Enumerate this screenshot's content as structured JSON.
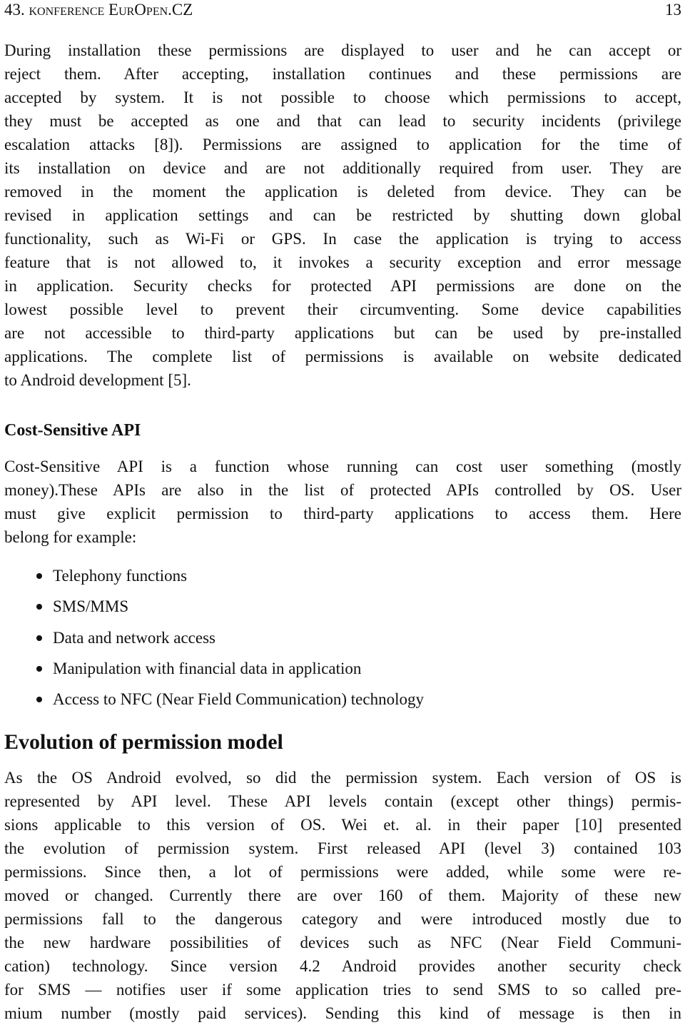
{
  "header": {
    "running_title": "43. konference EurOpen.CZ",
    "page_number": "13"
  },
  "paragraph1": {
    "lines": [
      "During installation these permissions are displayed to user and he can accept or",
      "reject them.  After accepting, installation continues and these permissions are",
      "accepted by system. It is not possible to choose which permissions to accept,",
      "they must be accepted as one and that can lead to security incidents (privilege",
      "escalation attacks [8]).  Permissions are assigned to application for the time of",
      "its installation on device and are not additionally required from user. They are",
      "removed in the moment the application is deleted from device.  They can be",
      "revised in application settings and can be restricted by shutting down global",
      "functionality, such as Wi-Fi or GPS. In case the application is trying to access",
      "feature that is not allowed to, it invokes a security exception and error message",
      "in application.  Security checks for protected API permissions are done on the",
      "lowest possible level to prevent their circumventing.  Some device capabilities",
      "are not accessible to third-party applications but can be used by pre-installed",
      "applications. The complete list of permissions is available on website dedicated",
      "to Android development [5]."
    ]
  },
  "subsection": {
    "title": "Cost-Sensitive API",
    "lines": [
      "Cost-Sensitive API is a function whose running can cost user something (mostly",
      "money).These APIs are also in the list of protected APIs controlled by OS. User",
      "must give explicit permission to third-party applications to access them.  Here",
      "belong for example:"
    ],
    "items": [
      "Telephony functions",
      "SMS/MMS",
      "Data and network access",
      "Manipulation with financial data in application",
      "Access to NFC (Near Field Communication) technology"
    ]
  },
  "section": {
    "title": "Evolution of permission model",
    "lines": [
      "As the OS Android evolved, so did the permission system. Each version of OS is",
      "represented by API level. These API levels contain (except other things) permis-",
      "sions applicable to this version of OS. Wei et. al. in their paper [10] presented",
      "the evolution of permission system.  First released API (level 3) contained 103",
      "permissions.  Since then, a lot of permissions were added, while some were re-",
      "moved or changed. Currently there are over 160 of them. Majority of these new",
      "permissions fall to the dangerous category and were introduced mostly due to",
      "the new hardware possibilities of devices such as NFC (Near Field Communi-",
      "cation) technology.  Since version 4.2 Android provides another security check",
      "for SMS — notifies user if some application tries to send SMS to so called pre-",
      "mium number (mostly paid services).  Sending this kind of message is then in"
    ]
  }
}
